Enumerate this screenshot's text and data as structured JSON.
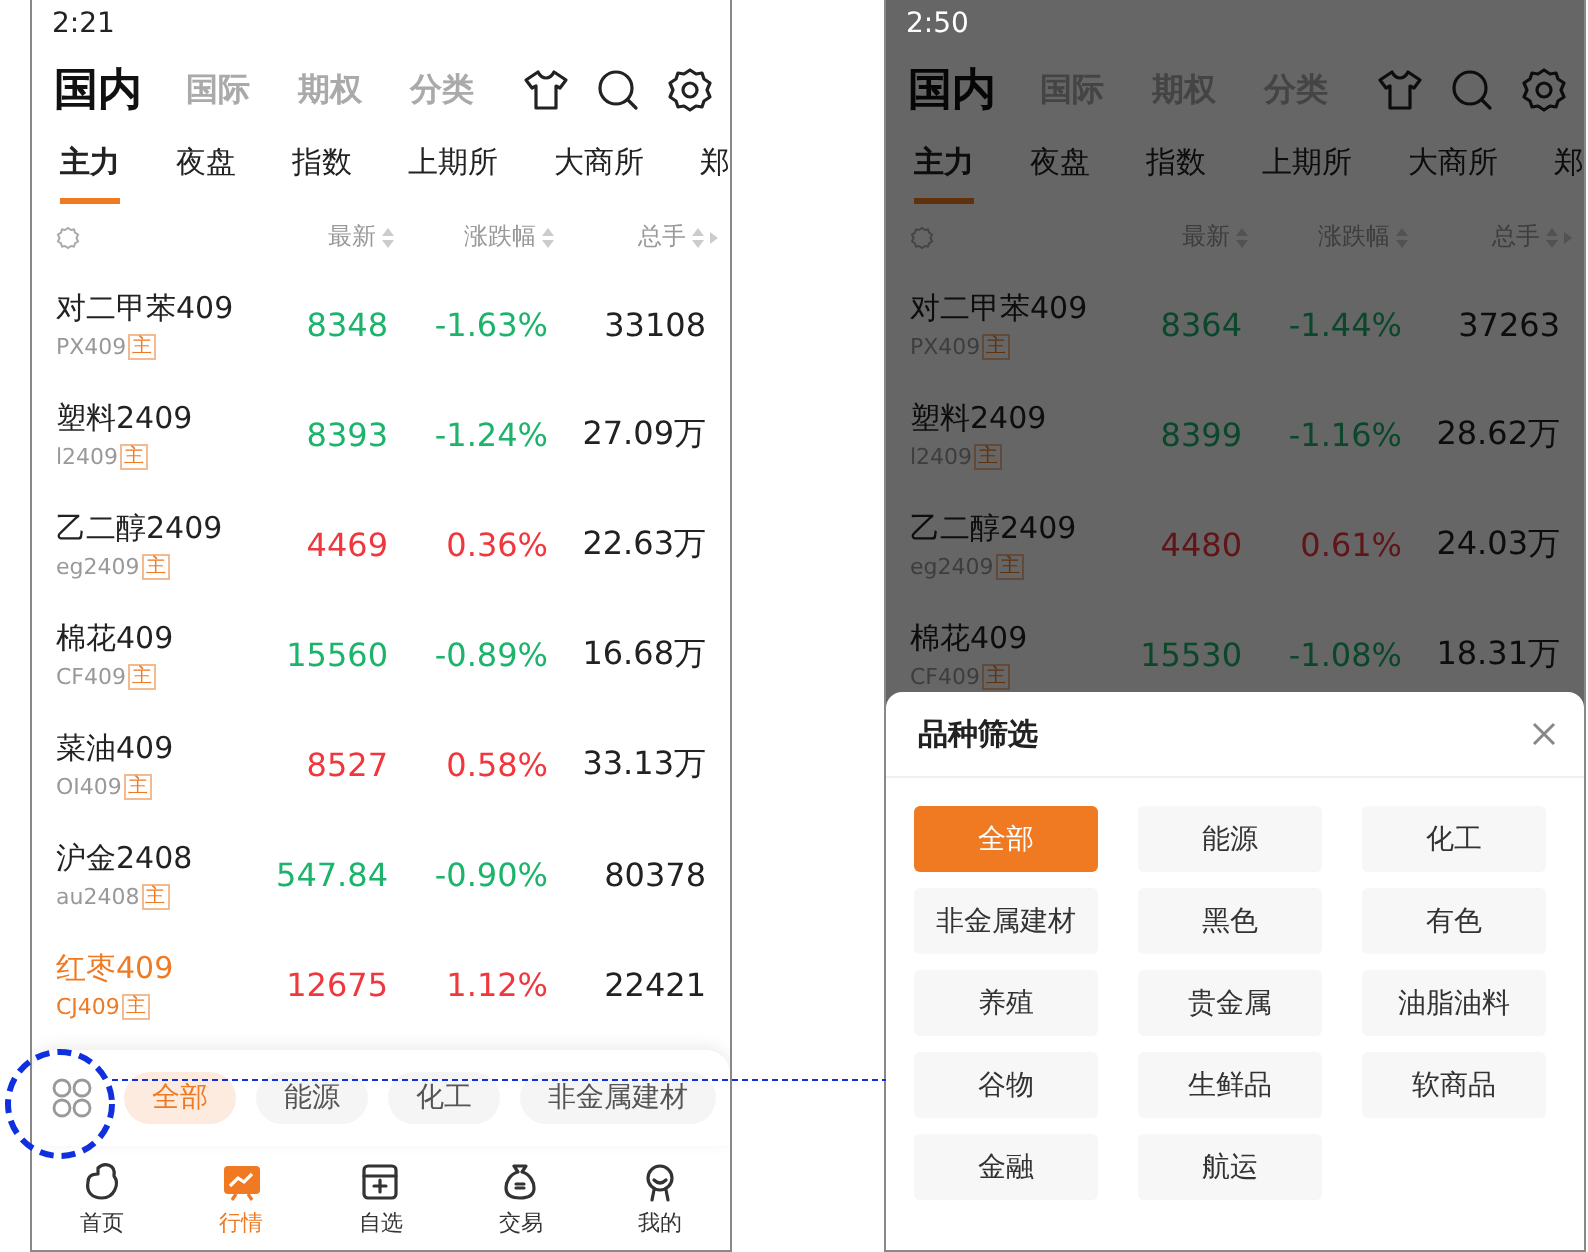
{
  "screens": [
    {
      "dimmed": false,
      "status_time": "2:21",
      "top_tabs": [
        {
          "label": "国内",
          "selected": true
        },
        {
          "label": "国际",
          "selected": false
        },
        {
          "label": "期权",
          "selected": false
        },
        {
          "label": "分类",
          "selected": false
        }
      ],
      "sub_tabs": [
        {
          "label": "主力",
          "selected": true
        },
        {
          "label": "夜盘",
          "selected": false
        },
        {
          "label": "指数",
          "selected": false
        },
        {
          "label": "上期所",
          "selected": false
        },
        {
          "label": "大商所",
          "selected": false
        },
        {
          "label": "郑",
          "selected": false
        }
      ],
      "columns": [
        "最新",
        "涨跌幅",
        "总手"
      ],
      "rows": [
        {
          "name": "对二甲苯409",
          "code": "PX409",
          "badge": "主",
          "price": "8348",
          "change": "-1.63%",
          "volume": "33108",
          "rising": false,
          "highlighted": false
        },
        {
          "name": "塑料2409",
          "code": "l2409",
          "badge": "主",
          "price": "8393",
          "change": "-1.24%",
          "volume": "27.09万",
          "rising": false,
          "highlighted": false
        },
        {
          "name": "乙二醇2409",
          "code": "eg2409",
          "badge": "主",
          "price": "4469",
          "change": "0.36%",
          "volume": "22.63万",
          "rising": true,
          "highlighted": false
        },
        {
          "name": "棉花409",
          "code": "CF409",
          "badge": "主",
          "price": "15560",
          "change": "-0.89%",
          "volume": "16.68万",
          "rising": false,
          "highlighted": false
        },
        {
          "name": "菜油409",
          "code": "OI409",
          "badge": "主",
          "price": "8527",
          "change": "0.58%",
          "volume": "33.13万",
          "rising": true,
          "highlighted": false
        },
        {
          "name": "沪金2408",
          "code": "au2408",
          "badge": "主",
          "price": "547.84",
          "change": "-0.90%",
          "volume": "80378",
          "rising": false,
          "highlighted": false
        },
        {
          "name": "红枣409",
          "code": "CJ409",
          "badge": "主",
          "price": "12675",
          "change": "1.12%",
          "volume": "22421",
          "rising": true,
          "highlighted": true
        }
      ],
      "filter_chips": [
        {
          "label": "全部",
          "selected": true
        },
        {
          "label": "能源",
          "selected": false
        },
        {
          "label": "化工",
          "selected": false
        },
        {
          "label": "非金属建材",
          "selected": false
        }
      ],
      "bottom_nav": [
        {
          "label": "首页",
          "selected": false
        },
        {
          "label": "行情",
          "selected": true
        },
        {
          "label": "自选",
          "selected": false
        },
        {
          "label": "交易",
          "selected": false
        },
        {
          "label": "我的",
          "selected": false
        }
      ]
    },
    {
      "dimmed": true,
      "status_time": "2:50",
      "top_tabs": [
        {
          "label": "国内",
          "selected": true
        },
        {
          "label": "国际",
          "selected": false
        },
        {
          "label": "期权",
          "selected": false
        },
        {
          "label": "分类",
          "selected": false
        }
      ],
      "sub_tabs": [
        {
          "label": "主力",
          "selected": true
        },
        {
          "label": "夜盘",
          "selected": false
        },
        {
          "label": "指数",
          "selected": false
        },
        {
          "label": "上期所",
          "selected": false
        },
        {
          "label": "大商所",
          "selected": false
        },
        {
          "label": "郑",
          "selected": false
        }
      ],
      "columns": [
        "最新",
        "涨跌幅",
        "总手"
      ],
      "rows": [
        {
          "name": "对二甲苯409",
          "code": "PX409",
          "badge": "主",
          "price": "8364",
          "change": "-1.44%",
          "volume": "37263",
          "rising": false,
          "highlighted": false
        },
        {
          "name": "塑料2409",
          "code": "l2409",
          "badge": "主",
          "price": "8399",
          "change": "-1.16%",
          "volume": "28.62万",
          "rising": false,
          "highlighted": false
        },
        {
          "name": "乙二醇2409",
          "code": "eg2409",
          "badge": "主",
          "price": "4480",
          "change": "0.61%",
          "volume": "24.03万",
          "rising": true,
          "highlighted": false
        },
        {
          "name": "棉花409",
          "code": "CF409",
          "badge": "主",
          "price": "15530",
          "change": "-1.08%",
          "volume": "18.31万",
          "rising": false,
          "highlighted": false
        }
      ],
      "filter_sheet": {
        "title": "品种筛选",
        "options": [
          {
            "label": "全部",
            "selected": true
          },
          {
            "label": "能源",
            "selected": false
          },
          {
            "label": "化工",
            "selected": false
          },
          {
            "label": "非金属建材",
            "selected": false
          },
          {
            "label": "黑色",
            "selected": false
          },
          {
            "label": "有色",
            "selected": false
          },
          {
            "label": "养殖",
            "selected": false
          },
          {
            "label": "贵金属",
            "selected": false
          },
          {
            "label": "油脂油料",
            "selected": false
          },
          {
            "label": "谷物",
            "selected": false
          },
          {
            "label": "生鲜品",
            "selected": false
          },
          {
            "label": "软商品",
            "selected": false
          },
          {
            "label": "金融",
            "selected": false
          },
          {
            "label": "航运",
            "selected": false
          }
        ]
      }
    }
  ]
}
